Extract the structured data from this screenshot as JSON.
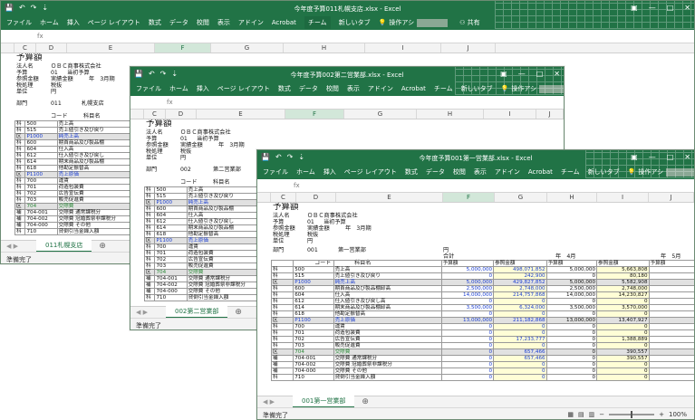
{
  "windows": [
    {
      "title": "今年度予算011札幌支店.xlsx - Excel",
      "ribbon_tabs": [
        "ファイル",
        "ホーム",
        "挿入",
        "ページ レイアウト",
        "数式",
        "データ",
        "校閲",
        "表示",
        "アドイン",
        "Acrobat",
        "チーム",
        "新しいタブ"
      ],
      "tell_me": "操作アシ",
      "share": "共有",
      "columns": [
        "C",
        "D",
        "E",
        "F",
        "G",
        "H",
        "I",
        "J"
      ],
      "sheet_tab": "011札幌支店",
      "status": "準備完了",
      "header": {
        "title": "予算額",
        "company_label": "法人名",
        "company": "ＯＢＣ商事株式会社",
        "budget_label": "予算",
        "budget_no": "01",
        "budget_name": "当初予算",
        "ref_label": "参照金額",
        "ref_value": "実績金額",
        "ref_year": "年　3月期",
        "tax_label": "税処理",
        "tax_value": "税抜",
        "unit_label": "単位",
        "unit_value": "円",
        "dept_label": "部門",
        "dept_code": "011",
        "dept_name": "札幌支店"
      },
      "col_code": "コード",
      "col_name": "科目名",
      "rows": [
        {
          "type": "科",
          "code": "500",
          "name": "売上高"
        },
        {
          "type": "科",
          "code": "515",
          "name": "売上値引き及び戻り"
        },
        {
          "type": "区",
          "code": "P1000",
          "name": "純売上高"
        },
        {
          "type": "科",
          "code": "600",
          "name": "期首商品及び製品棚"
        },
        {
          "type": "科",
          "code": "604",
          "name": "仕入高"
        },
        {
          "type": "科",
          "code": "612",
          "name": "仕入値引き及び戻し"
        },
        {
          "type": "科",
          "code": "614",
          "name": "期末商品及び製品棚"
        },
        {
          "type": "科",
          "code": "618",
          "name": "他勘定振替高"
        },
        {
          "type": "区",
          "code": "P1100",
          "name": "売上原価"
        },
        {
          "type": "科",
          "code": "700",
          "name": "運賃"
        },
        {
          "type": "科",
          "code": "701",
          "name": "荷造包装費"
        },
        {
          "type": "科",
          "code": "702",
          "name": "広告宣伝費"
        },
        {
          "type": "科",
          "code": "703",
          "name": "販売促進費"
        },
        {
          "type": "区",
          "code": "704",
          "name": "交際費"
        },
        {
          "type": "補",
          "code": "704-001",
          "name": "交際費 通常課税分"
        },
        {
          "type": "補",
          "code": "704-002",
          "name": "交際費 冠婚葬祭非課税分"
        },
        {
          "type": "補",
          "code": "704-000",
          "name": "交際費 その他"
        },
        {
          "type": "科",
          "code": "710",
          "name": "貸倒引当金繰入額"
        }
      ]
    },
    {
      "title": "今年度予算002第二営業部.xlsx - Excel",
      "ribbon_tabs": [
        "ファイル",
        "ホーム",
        "挿入",
        "ページ レイアウト",
        "数式",
        "データ",
        "校閲",
        "表示",
        "アドイン",
        "Acrobat",
        "チーム",
        "新しいタブ"
      ],
      "tell_me": "操作アシ",
      "share": "共有",
      "columns": [
        "C",
        "D",
        "E",
        "F",
        "G",
        "H",
        "I",
        "J"
      ],
      "sheet_tab": "002第二営業部",
      "status": "準備完了",
      "header": {
        "title": "予算額",
        "company_label": "法人名",
        "company": "ＯＢＣ商事株式会社",
        "budget_label": "予算",
        "budget_no": "01",
        "budget_name": "当初予算",
        "ref_label": "参照金額",
        "ref_value": "実績金額",
        "ref_year": "年　3月期",
        "tax_label": "税処理",
        "tax_value": "税抜",
        "unit_label": "単位",
        "unit_value": "円",
        "dept_label": "部門",
        "dept_code": "002",
        "dept_name": "第二営業部"
      },
      "col_code": "コード",
      "col_name": "科目名"
    },
    {
      "title": "今年度予算001第一営業部.xlsx - Excel",
      "ribbon_tabs": [
        "ファイル",
        "ホーム",
        "挿入",
        "ページ レイアウト",
        "数式",
        "データ",
        "校閲",
        "表示",
        "アドイン",
        "Acrobat",
        "チーム",
        "新しいタブ"
      ],
      "tell_me": "操作アシ",
      "share": "共有",
      "columns": [
        "C",
        "D",
        "E",
        "F",
        "G",
        "H",
        "I",
        "J"
      ],
      "sheet_tab": "001第一営業部",
      "status": "準備完了",
      "zoom": "100%",
      "header": {
        "title": "予算額",
        "company_label": "法人名",
        "company": "ＯＢＣ商事株式会社",
        "budget_label": "予算",
        "budget_no": "01",
        "budget_name": "当初予算",
        "ref_label": "参照金額",
        "ref_value": "実績金額",
        "ref_year": "年　3月期",
        "tax_label": "税処理",
        "tax_value": "税抜",
        "unit_label": "単位",
        "unit_value": "円",
        "dept_label": "部門",
        "dept_code": "001",
        "dept_name": "第一営業部"
      },
      "col_code": "コード",
      "col_name": "科目名",
      "period_total": "合計",
      "period_4": "年　4月",
      "period_5": "年　5月",
      "col_budget": "予算額",
      "col_ref": "参照金額",
      "rows": [
        {
          "type": "科",
          "code": "500",
          "name": "売上高",
          "v1": "5,000,000",
          "v2": "498,071,852",
          "v3": "5,000,000",
          "v4": "5,663,808"
        },
        {
          "type": "科",
          "code": "515",
          "name": "売上値引き及び戻り",
          "v1": "0",
          "v2": "242,900",
          "v3": "0",
          "v4": "80,180"
        },
        {
          "type": "区",
          "code": "P1000",
          "name": "純売上高",
          "v1": "5,000,000",
          "v2": "429,827,852",
          "v3": "5,000,000",
          "v4": "5,582,908"
        },
        {
          "type": "科",
          "code": "600",
          "name": "期首商品及び製品棚卸高",
          "v1": "2,500,000",
          "v2": "2,748,000",
          "v3": "2,500,000",
          "v4": "2,748,000"
        },
        {
          "type": "科",
          "code": "604",
          "name": "仕入高",
          "v1": "14,000,000",
          "v2": "214,757,868",
          "v3": "14,000,000",
          "v4": "14,230,827"
        },
        {
          "type": "科",
          "code": "612",
          "name": "仕入値引き及び戻し高",
          "v1": "0",
          "v2": "0",
          "v3": "0",
          "v4": "0"
        },
        {
          "type": "科",
          "code": "614",
          "name": "期末商品及び製品棚卸高",
          "v1": "3,500,000",
          "v2": "6,324,000",
          "v3": "3,500,000",
          "v4": "3,570,000"
        },
        {
          "type": "科",
          "code": "618",
          "name": "他勘定振替高",
          "v1": "0",
          "v2": "0",
          "v3": "0",
          "v4": "0"
        },
        {
          "type": "区",
          "code": "P1100",
          "name": "売上原価",
          "v1": "13,000,000",
          "v2": "211,182,868",
          "v3": "13,000,000",
          "v4": "13,407,927"
        },
        {
          "type": "科",
          "code": "700",
          "name": "運賃",
          "v1": "0",
          "v2": "0",
          "v3": "0",
          "v4": "0"
        },
        {
          "type": "科",
          "code": "701",
          "name": "荷造包装費",
          "v1": "0",
          "v2": "0",
          "v3": "0",
          "v4": "0"
        },
        {
          "type": "科",
          "code": "702",
          "name": "広告宣伝費",
          "v1": "0",
          "v2": "17,233,777",
          "v3": "0",
          "v4": "1,388,889"
        },
        {
          "type": "科",
          "code": "703",
          "name": "販売促進費",
          "v1": "0",
          "v2": "0",
          "v3": "0",
          "v4": "0"
        },
        {
          "type": "区",
          "code": "704",
          "name": "交際費",
          "v1": "0",
          "v2": "657,466",
          "v3": "0",
          "v4": "390,557"
        },
        {
          "type": "補",
          "code": "704-001",
          "name": "交際費 通常課税分",
          "v1": "0",
          "v2": "657,466",
          "v3": "0",
          "v4": "390,557"
        },
        {
          "type": "補",
          "code": "704-002",
          "name": "交際費 冠婚葬祭非課税分",
          "v1": "0",
          "v2": "0",
          "v3": "0",
          "v4": "0"
        },
        {
          "type": "補",
          "code": "704-000",
          "name": "交際費 その他",
          "v1": "0",
          "v2": "0",
          "v3": "0",
          "v4": "0"
        },
        {
          "type": "科",
          "code": "710",
          "name": "貸倒引当金繰入額",
          "v1": "0",
          "v2": "0",
          "v3": "0",
          "v4": "0"
        }
      ]
    }
  ],
  "icons": {
    "save": "save-icon",
    "undo": "undo-icon",
    "redo": "redo-icon",
    "search": "lightbulb-icon",
    "user": "person-icon"
  },
  "colors": {
    "excel_green": "#217346",
    "blue_text": "#1c3fd1",
    "green_text": "#2d8a3a",
    "highlight_yellow": "#fffed6"
  }
}
